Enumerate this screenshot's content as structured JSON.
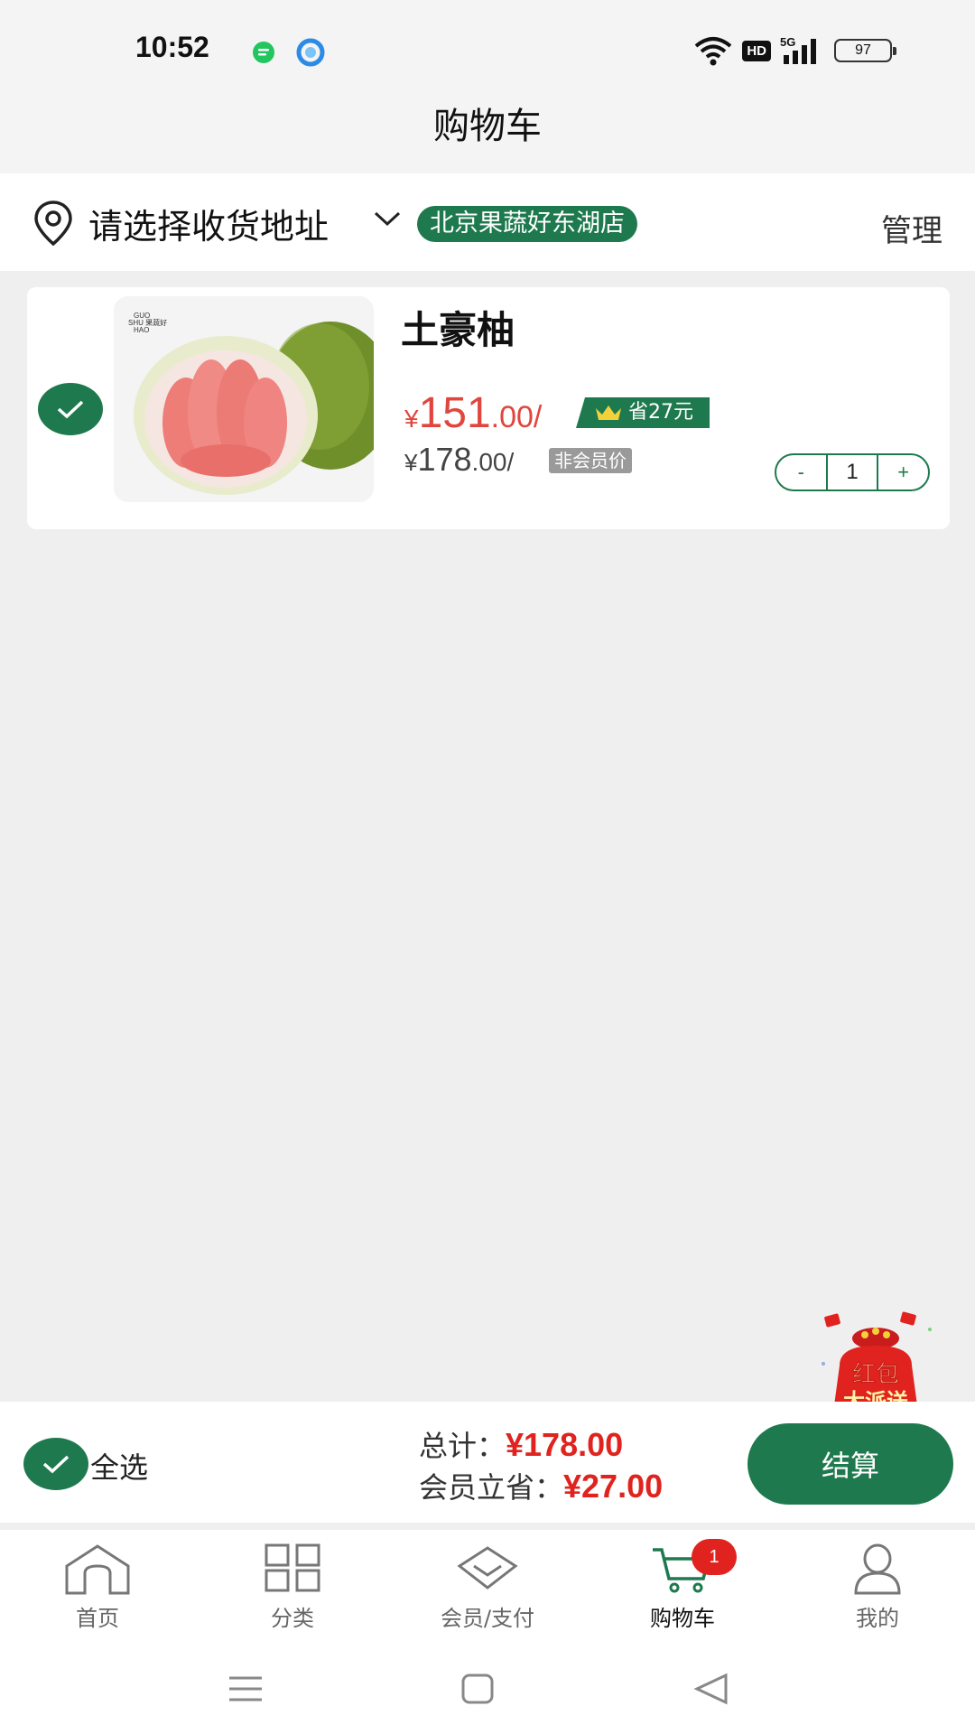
{
  "status_bar": {
    "time": "10:52",
    "network": "5G",
    "hd_label": "HD",
    "battery": "97"
  },
  "header": {
    "title": "购物车"
  },
  "address_bar": {
    "prompt": "请选择收货地址",
    "store": "北京果蔬好东湖店",
    "manage_label": "管理"
  },
  "cart_items": [
    {
      "name": "土豪柚",
      "image_logo_text": "GUO SHU 果蔬好 HAO",
      "member_price_symbol": "¥",
      "member_price_int": "151",
      "member_price_dec": ".00/",
      "save_badge": "省27元",
      "orig_price_symbol": "¥",
      "orig_price_int": "178",
      "orig_price_dec": ".00/",
      "nonmember_label": "非会员价",
      "qty_minus": "-",
      "quantity": "1",
      "qty_plus": "+",
      "selected": true
    }
  ],
  "promo": {
    "redpacket_line1": "红包",
    "redpacket_line2": "大派送"
  },
  "checkout": {
    "select_all_label": "全选",
    "total_label": "总计：",
    "total_amount": "¥178.00",
    "member_save_label": "会员立省：",
    "member_save_amount": "¥27.00",
    "checkout_label": "结算"
  },
  "tab_bar": {
    "tabs": [
      {
        "label": "首页",
        "icon": "home-icon"
      },
      {
        "label": "分类",
        "icon": "category-grid-icon"
      },
      {
        "label": "会员/支付",
        "icon": "diamond-icon"
      },
      {
        "label": "购物车",
        "icon": "cart-icon",
        "active": true,
        "badge": "1"
      },
      {
        "label": "我的",
        "icon": "user-icon"
      }
    ]
  },
  "colors": {
    "brand_green": "#1e7a4e",
    "price_red": "#e0463d",
    "amount_red": "#e0231e",
    "background": "#efefef"
  }
}
